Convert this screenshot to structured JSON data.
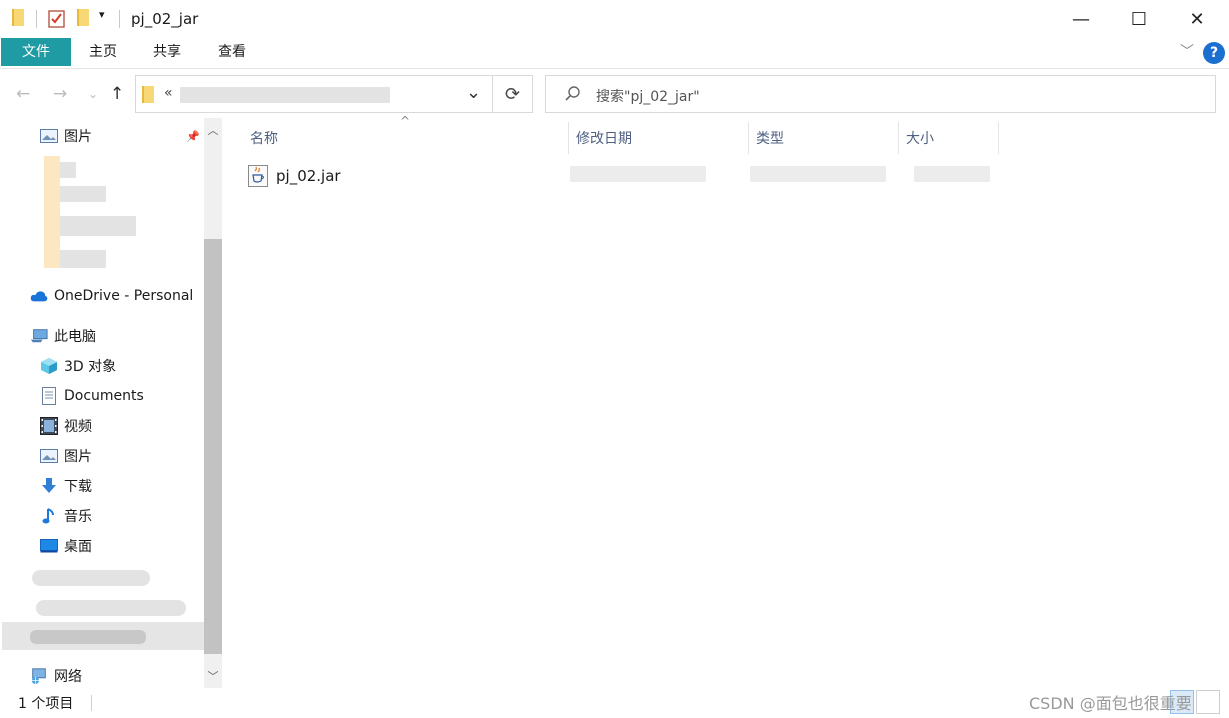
{
  "window": {
    "title": "pj_02_jar",
    "minimize": "—",
    "maximize": "☐",
    "close": "✕"
  },
  "ribbon": {
    "tabs": [
      {
        "label": "文件",
        "active": true
      },
      {
        "label": "主页"
      },
      {
        "label": "共享"
      },
      {
        "label": "查看"
      }
    ],
    "expand_icon": "﹀",
    "help_label": "?"
  },
  "address": {
    "prefix": "«",
    "dropdown": "⌄",
    "refresh": "⟳"
  },
  "search": {
    "placeholder": "搜索\"pj_02_jar\""
  },
  "sidebar": {
    "pinned": {
      "label": "图片",
      "pin_icon": "📌"
    },
    "onedrive": {
      "label": "OneDrive - Personal"
    },
    "this_pc": {
      "label": "此电脑"
    },
    "items": [
      {
        "label": "3D 对象",
        "icon": "cube-3d-icon"
      },
      {
        "label": "Documents",
        "icon": "document-icon"
      },
      {
        "label": "视频",
        "icon": "video-icon"
      },
      {
        "label": "图片",
        "icon": "picture-icon"
      },
      {
        "label": "下载",
        "icon": "download-icon"
      },
      {
        "label": "音乐",
        "icon": "music-icon"
      },
      {
        "label": "桌面",
        "icon": "desktop-icon"
      }
    ],
    "network": {
      "label": "网络"
    }
  },
  "columns": {
    "name": "名称",
    "modified": "修改日期",
    "type": "类型",
    "size": "大小",
    "sort_indicator": "^"
  },
  "files": [
    {
      "name": "pj_02.jar"
    }
  ],
  "status": {
    "count": "1 个项目",
    "watermark": "CSDN @面包也很重要"
  },
  "colors": {
    "file_tab": "#1f9ca3",
    "accent": "#1a6fd1"
  }
}
